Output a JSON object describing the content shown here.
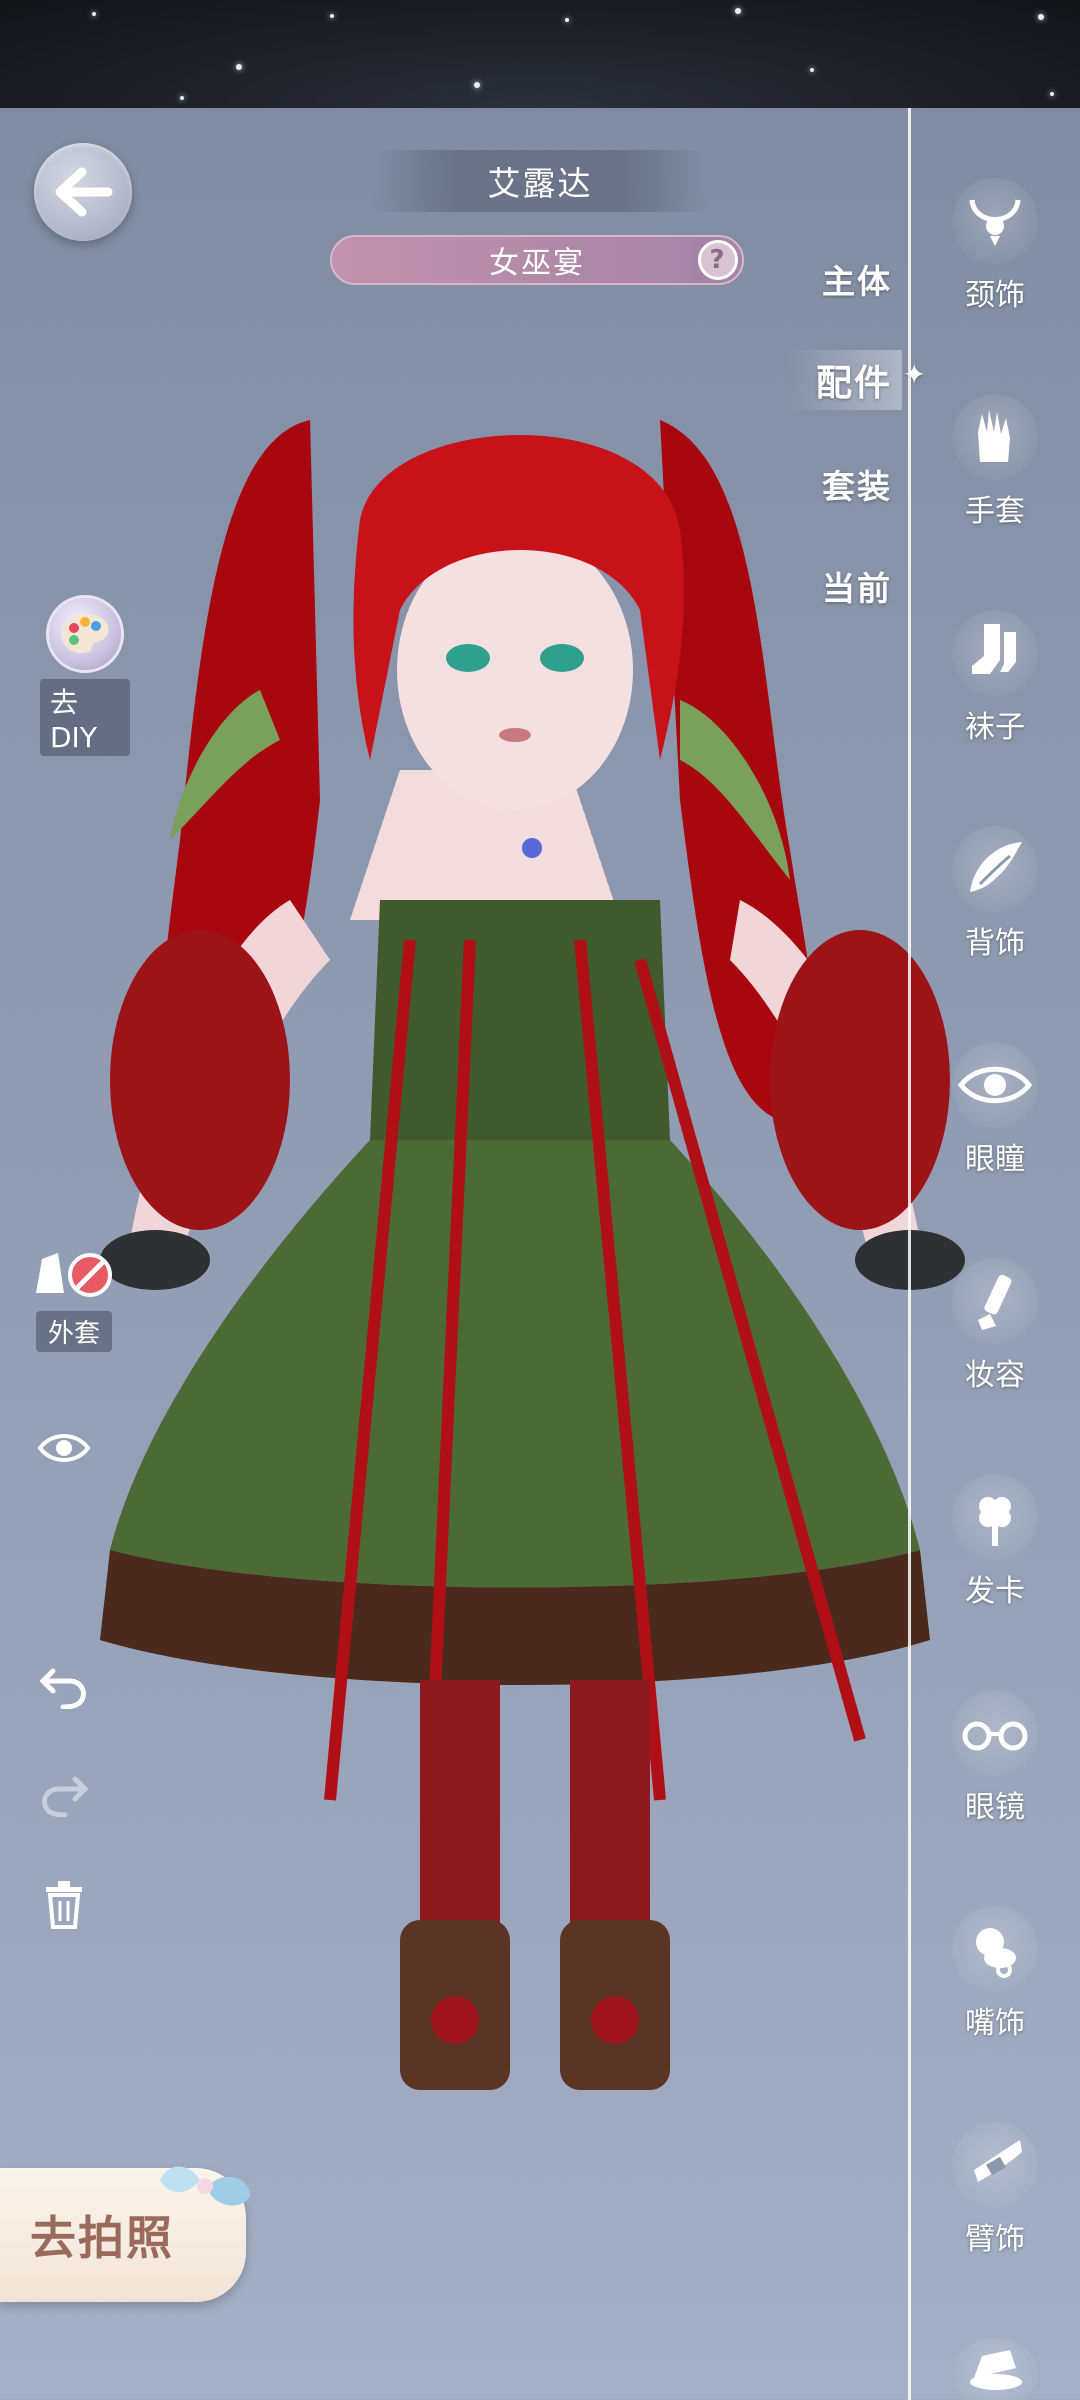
{
  "header": {
    "character_name": "艾露达",
    "outfit_name": "女巫宴",
    "help_symbol": "?"
  },
  "category_tabs": [
    {
      "label": "主体",
      "active": false
    },
    {
      "label": "配件",
      "active": true
    },
    {
      "label": "套装",
      "active": false
    },
    {
      "label": "当前",
      "active": false
    }
  ],
  "accessory_sidebar": [
    {
      "label": "颈饰",
      "icon": "necklace-icon"
    },
    {
      "label": "手套",
      "icon": "glove-icon"
    },
    {
      "label": "袜子",
      "icon": "socks-icon"
    },
    {
      "label": "背饰",
      "icon": "wing-icon"
    },
    {
      "label": "眼瞳",
      "icon": "eye-icon"
    },
    {
      "label": "妆容",
      "icon": "makeup-brush-icon"
    },
    {
      "label": "发卡",
      "icon": "hairclip-icon"
    },
    {
      "label": "眼镜",
      "icon": "glasses-icon"
    },
    {
      "label": "嘴饰",
      "icon": "pacifier-icon"
    },
    {
      "label": "臂饰",
      "icon": "armband-icon"
    },
    {
      "label": "",
      "icon": "hat-icon"
    }
  ],
  "left_tools": {
    "diy_label": "去DIY",
    "coat_label": "外套",
    "photo_label": "去拍照"
  },
  "colors": {
    "background": "#8d98ae",
    "hair": "#c8121a",
    "dress": "#3f5a2c",
    "pill": "#b58ba9"
  }
}
